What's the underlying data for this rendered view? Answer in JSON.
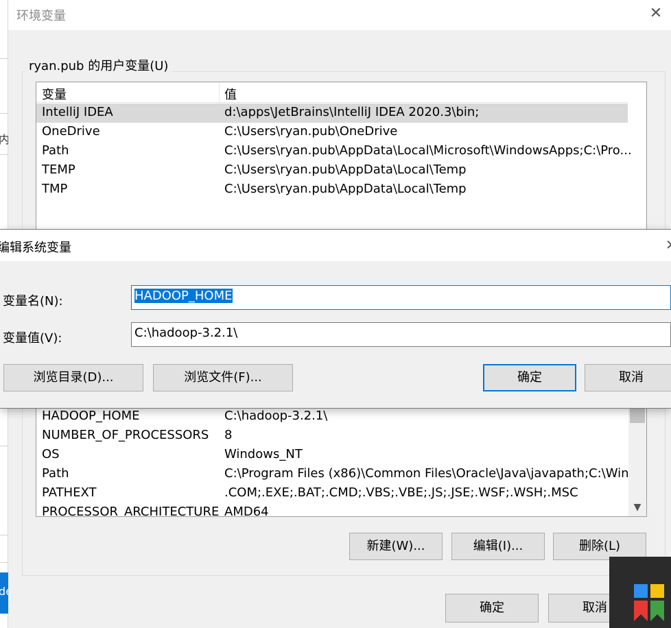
{
  "env_window": {
    "title": "环境变量",
    "user_group_label": "ryan.pub 的用户变量(U)",
    "columns": {
      "name": "变量",
      "value": "值"
    },
    "user_vars": [
      {
        "name": "IntelliJ IDEA",
        "value": "d:\\apps\\JetBrains\\IntelliJ IDEA 2020.3\\bin;"
      },
      {
        "name": "OneDrive",
        "value": "C:\\Users\\ryan.pub\\OneDrive"
      },
      {
        "name": "Path",
        "value": "C:\\Users\\ryan.pub\\AppData\\Local\\Microsoft\\WindowsApps;C:\\Pro..."
      },
      {
        "name": "TEMP",
        "value": "C:\\Users\\ryan.pub\\AppData\\Local\\Temp"
      },
      {
        "name": "TMP",
        "value": "C:\\Users\\ryan.pub\\AppData\\Local\\Temp"
      }
    ],
    "system_vars": [
      {
        "name": "HADOOP_HOME",
        "value": "C:\\hadoop-3.2.1\\"
      },
      {
        "name": "NUMBER_OF_PROCESSORS",
        "value": "8"
      },
      {
        "name": "OS",
        "value": "Windows_NT"
      },
      {
        "name": "Path",
        "value": "C:\\Program Files (x86)\\Common Files\\Oracle\\Java\\javapath;C:\\Win..."
      },
      {
        "name": "PATHEXT",
        "value": ".COM;.EXE;.BAT;.CMD;.VBS;.VBE;.JS;.JSE;.WSF;.WSH;.MSC"
      },
      {
        "name": "PROCESSOR_ARCHITECTURE",
        "value": "AMD64"
      }
    ],
    "buttons": {
      "new": "新建(W)...",
      "edit": "编辑(I)...",
      "delete": "删除(L)",
      "ok": "确定",
      "cancel": "取消"
    }
  },
  "edit_dialog": {
    "title": "编辑系统变量",
    "name_label": "变量名(N):",
    "name_value": "HADOOP_HOME",
    "value_label": "变量值(V):",
    "value_value": "C:\\hadoop-3.2.1\\",
    "buttons": {
      "browse_dir": "浏览目录(D)...",
      "browse_file": "浏览文件(F)...",
      "ok": "确定",
      "cancel": "取消"
    }
  },
  "background": {
    "left_fragment_text": "内",
    "left_fragment_text2": "de"
  },
  "colors": {
    "accent": "#0078d7",
    "logo_blue": "#2f8ff0",
    "logo_yellow": "#f5c211",
    "logo_red": "#e53935",
    "logo_green": "#43a047"
  }
}
